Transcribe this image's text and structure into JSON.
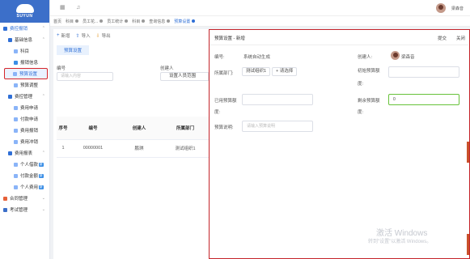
{
  "app": {
    "logo_text": "SUYUN",
    "user_name": "梁森音"
  },
  "sidebar": {
    "items": [
      {
        "label": "费控报销",
        "level": 1,
        "kind": "group",
        "expanded": true
      },
      {
        "label": "基础信息",
        "level": 2,
        "kind": "group",
        "expanded": true
      },
      {
        "label": "科目",
        "level": 3,
        "kind": "leaf"
      },
      {
        "label": "报销信息",
        "level": 3,
        "kind": "leaf"
      },
      {
        "label": "预算设置",
        "level": 3,
        "kind": "leaf",
        "active": true
      },
      {
        "label": "预算调整",
        "level": 3,
        "kind": "leaf"
      },
      {
        "label": "费控管理",
        "level": 2,
        "kind": "group",
        "expanded": true
      },
      {
        "label": "费用申请",
        "level": 3,
        "kind": "leaf"
      },
      {
        "label": "付款申请",
        "level": 3,
        "kind": "leaf"
      },
      {
        "label": "费用报销",
        "level": 3,
        "kind": "leaf"
      },
      {
        "label": "费用冲销",
        "level": 3,
        "kind": "leaf"
      },
      {
        "label": "费用报表",
        "level": 2,
        "kind": "group",
        "expanded": true
      },
      {
        "label": "个人借款",
        "level": 3,
        "kind": "leaf",
        "badge": "新"
      },
      {
        "label": "付款金额",
        "level": 3,
        "kind": "leaf",
        "badge": "新"
      },
      {
        "label": "个人费用",
        "level": 3,
        "kind": "leaf",
        "badge": "新"
      },
      {
        "label": "合同管理",
        "level": 1,
        "kind": "group",
        "expanded": false
      },
      {
        "label": "考试管理",
        "level": 1,
        "kind": "group",
        "expanded": false
      }
    ]
  },
  "tabs": [
    {
      "label": "首页",
      "active": false
    },
    {
      "label": "科目",
      "active": false
    },
    {
      "label": "员工花...",
      "active": false
    },
    {
      "label": "员工统计",
      "active": false
    },
    {
      "label": "科目",
      "active": false
    },
    {
      "label": "查询信息",
      "active": false
    },
    {
      "label": "预算设置",
      "active": true
    }
  ],
  "list": {
    "toolbar": {
      "add": "新增",
      "import": "导入",
      "export": "导出"
    },
    "subtab": "预算设置",
    "filter": {
      "code_label": "编号",
      "code_placeholder": "请输入内容",
      "creator_label": "创建人",
      "creator_value": "设置人员范围"
    },
    "table": {
      "headers": [
        "序号",
        "编号",
        "创建人",
        "所属部门"
      ],
      "rows": [
        [
          "1",
          "00000001",
          "鹏琪",
          "测试组织1"
        ]
      ]
    }
  },
  "modal": {
    "title": "预算设置 - 新增",
    "submit": "提交",
    "close": "关闭",
    "code_label": "编号:",
    "code_value": "系统自动生成",
    "creator_label": "创建人:",
    "creator_value": "梁森音",
    "dept_label": "所属部门:",
    "dept_chip": "测试组织1",
    "select_btn": "+ 请选择",
    "init_amount_label": "初始预算额",
    "init_amount_label2": "度:",
    "used_amount_label": "已用预算额",
    "used_amount_label2": "度:",
    "remain_amount_label": "剩余预算额",
    "remain_amount_label2": "度:",
    "remain_amount_value": "0",
    "desc_label": "预算说明:",
    "desc_placeholder": "请输入预算说明"
  },
  "watermark": {
    "line1": "激活 Windows",
    "line2": "转到\"设置\"以激活 Windows。"
  },
  "colors": {
    "brand": "#3c6fc9",
    "accent": "#2f6fd6",
    "highlight_border": "#c4242a",
    "success_border": "#67c23a"
  }
}
